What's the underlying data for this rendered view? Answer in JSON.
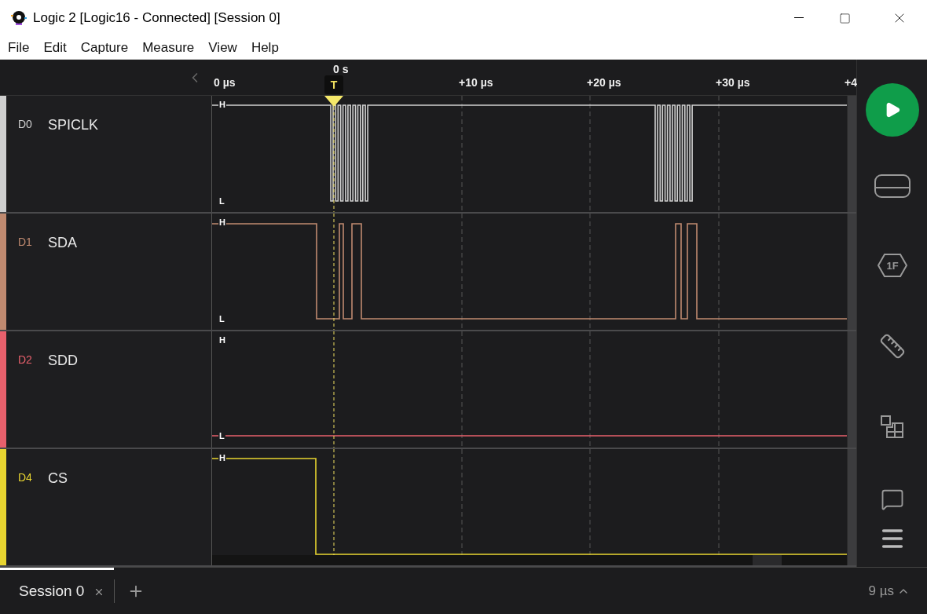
{
  "window": {
    "title": "Logic 2 [Logic16 - Connected] [Session 0]"
  },
  "menu": [
    "File",
    "Edit",
    "Capture",
    "Measure",
    "View",
    "Help"
  ],
  "timeline": {
    "ticks": [
      "0 µs",
      "+10 µs",
      "+20 µs",
      "+30 µs",
      "+4"
    ],
    "trigger_time": "0 s",
    "trigger_label": "T"
  },
  "channels": [
    {
      "id": "D0",
      "name": "SPICLK",
      "color": "#cfcfcf",
      "high_label": "H",
      "low_label": "L"
    },
    {
      "id": "D1",
      "name": "SDA",
      "color": "#c08a70",
      "high_label": "H",
      "low_label": "L"
    },
    {
      "id": "D2",
      "name": "SDD",
      "color": "#e8606c",
      "high_label": "H",
      "low_label": "L"
    },
    {
      "id": "D4",
      "name": "CS",
      "color": "#e8d530",
      "high_label": "H"
    }
  ],
  "sidebar": {
    "analyzer_badge": "1F"
  },
  "tabs": [
    {
      "label": "Session 0",
      "selected": true
    }
  ],
  "status": {
    "duration": "9 µs"
  }
}
